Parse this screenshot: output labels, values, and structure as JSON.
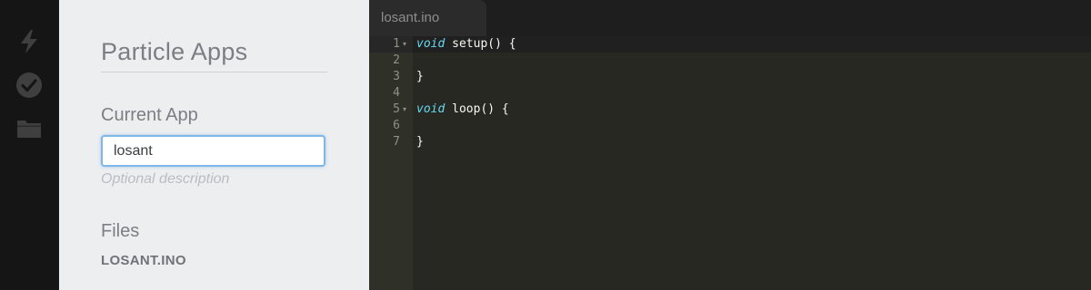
{
  "rail": {
    "icons": [
      {
        "name": "flash-icon",
        "label": "Flash"
      },
      {
        "name": "verify-icon",
        "label": "Verify"
      },
      {
        "name": "folder-icon",
        "label": "Files"
      }
    ]
  },
  "panel": {
    "title": "Particle Apps",
    "current_app_label": "Current App",
    "app_name_value": "losant",
    "description_placeholder": "Optional description",
    "files_label": "Files",
    "files": [
      "LOSANT.INO"
    ]
  },
  "editor": {
    "tab_label": "losant.ino",
    "lines": [
      {
        "number": "1",
        "fold": true,
        "keyword": "void",
        "rest": " setup() {"
      },
      {
        "number": "2",
        "fold": false,
        "keyword": "",
        "rest": ""
      },
      {
        "number": "3",
        "fold": false,
        "keyword": "",
        "rest": "}"
      },
      {
        "number": "4",
        "fold": false,
        "keyword": "",
        "rest": ""
      },
      {
        "number": "5",
        "fold": true,
        "keyword": "void",
        "rest": " loop() {"
      },
      {
        "number": "6",
        "fold": false,
        "keyword": "",
        "rest": ""
      },
      {
        "number": "7",
        "fold": false,
        "keyword": "",
        "rest": "}"
      }
    ]
  },
  "colors": {
    "rail_bg": "#151515",
    "panel_bg": "#eceef0",
    "editor_bg": "#272822",
    "keyword": "#66d9ef",
    "input_focus": "#7fb7e8"
  }
}
